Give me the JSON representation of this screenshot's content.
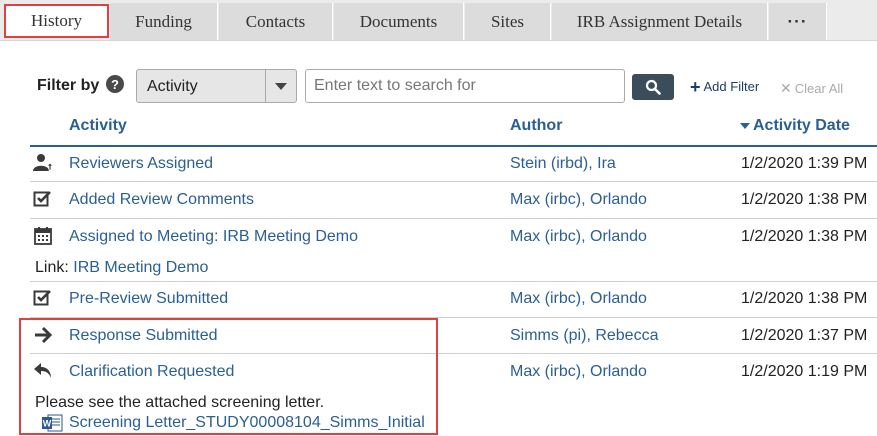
{
  "tabs": [
    {
      "label": "History",
      "active": true
    },
    {
      "label": "Funding"
    },
    {
      "label": "Contacts"
    },
    {
      "label": "Documents"
    },
    {
      "label": "Sites"
    },
    {
      "label": "IRB Assignment Details"
    },
    {
      "label": "···"
    }
  ],
  "filter": {
    "label": "Filter by",
    "help_icon": "?",
    "select_value": "Activity",
    "search_placeholder": "Enter text to search for",
    "add_filter_label": "Add Filter",
    "clear_all_label": "Clear All"
  },
  "table": {
    "headers": {
      "activity": "Activity",
      "author": "Author",
      "date": "Activity Date"
    },
    "rows": [
      {
        "icon": "reviewers-assigned-icon",
        "activity": "Reviewers Assigned",
        "author": "Stein (irbd), Ira",
        "date": "1/2/2020 1:39 PM"
      },
      {
        "icon": "checkbox-icon",
        "activity": "Added Review Comments",
        "author": "Max (irbc), Orlando",
        "date": "1/2/2020 1:38 PM"
      },
      {
        "icon": "calendar-icon",
        "activity": "Assigned to Meeting: IRB Meeting Demo",
        "author": "Max (irbc), Orlando",
        "date": "1/2/2020 1:38 PM",
        "link_prefix": "Link:",
        "link_text": "IRB Meeting Demo"
      },
      {
        "icon": "checkbox-icon",
        "activity": "Pre-Review Submitted",
        "author": "Max (irbc), Orlando",
        "date": "1/2/2020 1:38 PM"
      },
      {
        "icon": "arrow-right-icon",
        "activity": "Response Submitted",
        "author": "Simms (pi), Rebecca",
        "date": "1/2/2020 1:37 PM"
      },
      {
        "icon": "reply-arrow-icon",
        "activity": "Clarification Requested",
        "author": "Max (irbc), Orlando",
        "date": "1/2/2020 1:19 PM",
        "note": "Please see the attached screening letter.",
        "attachment": "Screening Letter_STUDY00008104_Simms_Initial"
      }
    ]
  },
  "colors": {
    "link": "#2a5f94",
    "highlight": "#e04040",
    "search_button": "#3b4d5a"
  }
}
